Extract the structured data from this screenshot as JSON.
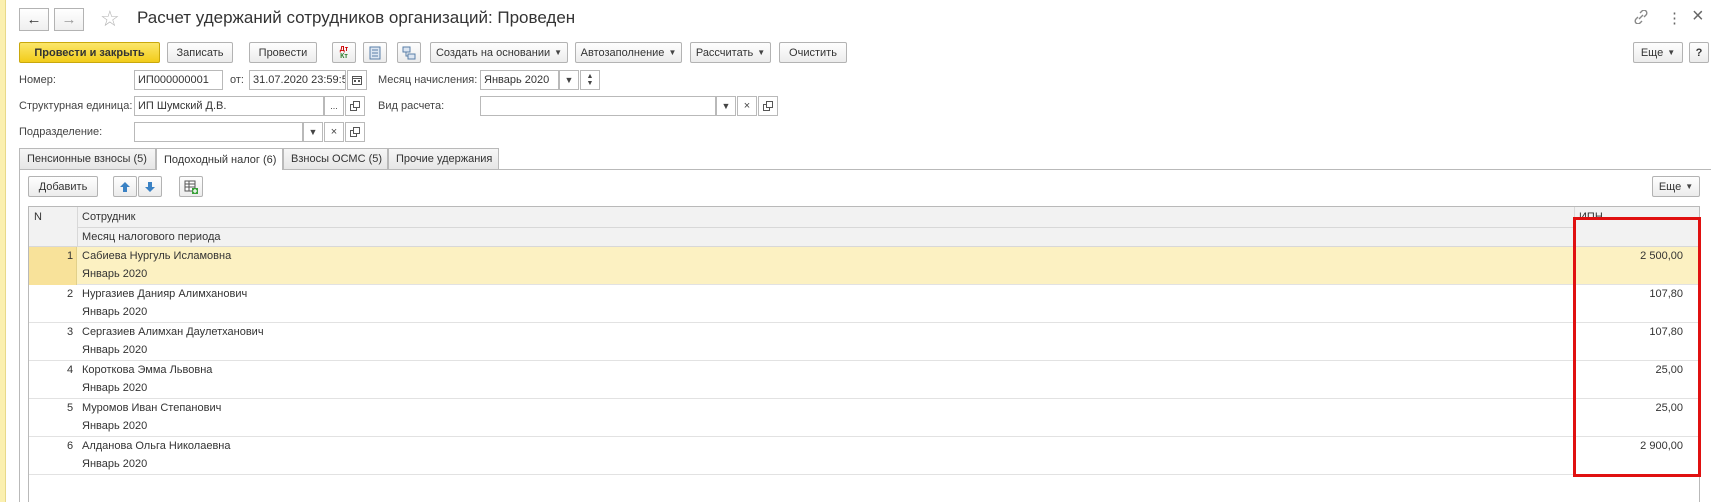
{
  "window": {
    "title": "Расчет удержаний сотрудников организаций: Проведен",
    "back_icon": "←",
    "forward_icon": "→",
    "star_icon": "☆",
    "link_icon": "🔗",
    "menu_icon": "⋮",
    "close_icon": "×"
  },
  "toolbar": {
    "post_close": "Провести и закрыть",
    "save": "Записать",
    "post": "Провести",
    "dtkt": "Дт Кт",
    "create_based": "Создать на основании",
    "autofill": "Автозаполнение",
    "calculate": "Рассчитать",
    "clear": "Очистить",
    "more": "Еще",
    "help": "?"
  },
  "form": {
    "number_label": "Номер:",
    "number_value": "ИП000000001",
    "date_label": "от:",
    "date_value": "31.07.2020 23:59:59",
    "month_label": "Месяц начисления:",
    "month_value": "Январь 2020",
    "org_label": "Структурная единица:",
    "org_value": "ИП Шумский Д.В.",
    "calc_type_label": "Вид расчета:",
    "calc_type_value": "",
    "division_label": "Подразделение:",
    "division_value": ""
  },
  "tabs": [
    {
      "label": "Пенсионные взносы (5)"
    },
    {
      "label": "Подоходный налог (6)"
    },
    {
      "label": "Взносы ОСМС (5)"
    },
    {
      "label": "Прочие удержания"
    }
  ],
  "table_toolbar": {
    "add": "Добавить",
    "more": "Еще"
  },
  "table": {
    "headers": {
      "n": "N",
      "employee": "Сотрудник",
      "tax_month": "Месяц налогового периода",
      "ipn": "ИПН"
    },
    "rows": [
      {
        "n": "1",
        "employee": "Сабиева Нургуль Исламовна",
        "month": "Январь 2020",
        "ipn": "2 500,00"
      },
      {
        "n": "2",
        "employee": "Нургазиев Данияр Алимханович",
        "month": "Январь 2020",
        "ipn": "107,80"
      },
      {
        "n": "3",
        "employee": "Сергазиев Алимхан Даулетханович",
        "month": "Январь 2020",
        "ipn": "107,80"
      },
      {
        "n": "4",
        "employee": "Короткова Эмма Львовна",
        "month": "Январь 2020",
        "ipn": "25,00"
      },
      {
        "n": "5",
        "employee": "Муромов Иван Степанович",
        "month": "Январь 2020",
        "ipn": "25,00"
      },
      {
        "n": "6",
        "employee": "Алданова Ольга Николаевна",
        "month": "Январь 2020",
        "ipn": "2 900,00"
      }
    ]
  },
  "colors": {
    "primary_button": "#f2cc1a",
    "selected_row": "#fcf1c2",
    "highlight_box": "#e01010"
  }
}
